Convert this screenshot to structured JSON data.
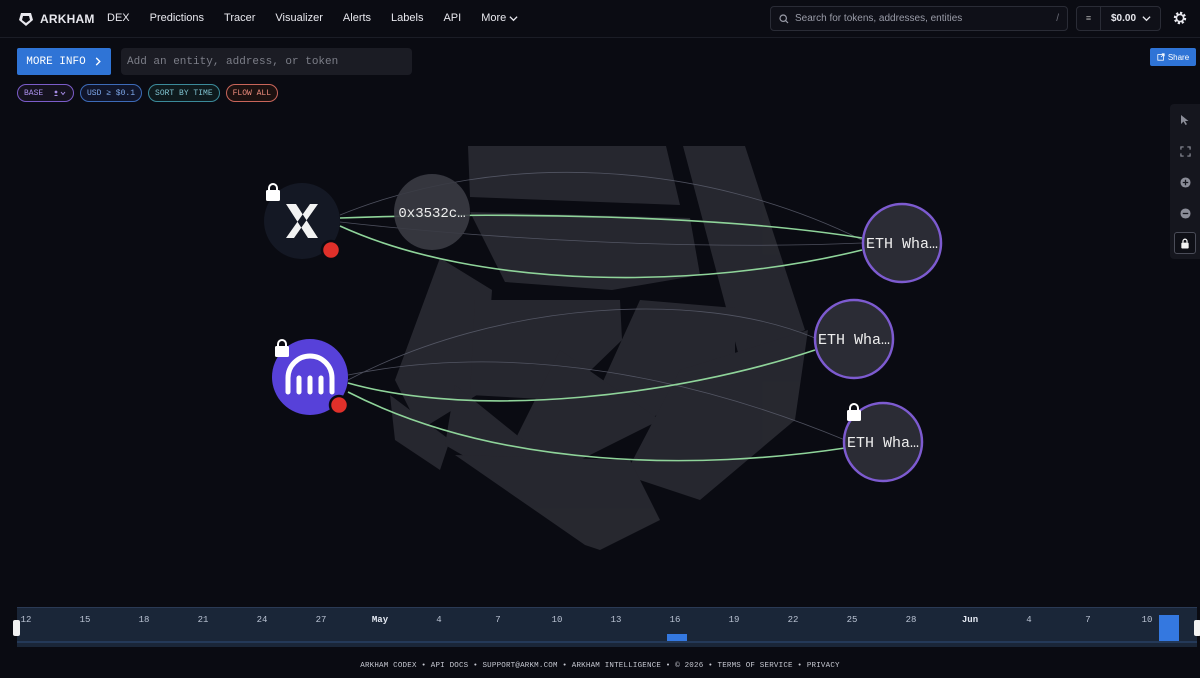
{
  "header": {
    "brand": "ARKHAM",
    "nav": [
      {
        "label": "DEX"
      },
      {
        "label": "Predictions"
      },
      {
        "label": "Tracer"
      },
      {
        "label": "Visualizer"
      },
      {
        "label": "Alerts"
      },
      {
        "label": "Labels"
      },
      {
        "label": "API"
      },
      {
        "label": "More"
      }
    ],
    "search_placeholder": "Search for tokens, addresses, entities",
    "search_shortcut": "/",
    "wallet_symbol": "≡",
    "wallet_amount": "$0.00"
  },
  "controls": {
    "more_info_label": "MORE INFO",
    "entity_placeholder": "Add an entity, address, or token",
    "chips": {
      "base": "BASE",
      "usd": "USD ≥ $0.1",
      "sort": "SORT BY TIME",
      "flow": "FLOW ALL"
    },
    "share_label": "Share"
  },
  "graph": {
    "address_node": "0x3532c…",
    "whale_nodes": [
      "ETH Wha…",
      "ETH Wha…",
      "ETH Wha…"
    ]
  },
  "timeline": {
    "ticks": [
      "12",
      "15",
      "18",
      "21",
      "24",
      "27",
      "May",
      "4",
      "7",
      "10",
      "13",
      "16",
      "19",
      "22",
      "25",
      "28",
      "Jun",
      "4",
      "7",
      "10"
    ],
    "month_ticks": [
      "May",
      "Jun"
    ]
  },
  "footer": {
    "text": "ARKHAM CODEX • API DOCS • SUPPORT@ARKM.COM • ARKHAM INTELLIGENCE • © 2026 • TERMS OF SERVICE • PRIVACY"
  },
  "colors": {
    "accent": "#2f74d6",
    "edge": "#8fd49a",
    "whale_ring": "#7d5bd0",
    "kraken": "#5741d9",
    "alert_dot": "#e0302a"
  }
}
